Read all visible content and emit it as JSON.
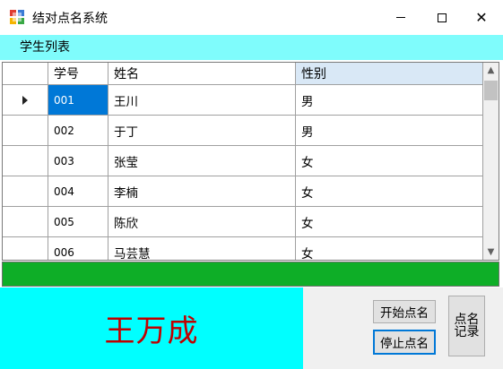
{
  "window": {
    "title": "结对点名系统",
    "minimize_icon": "minimize-icon",
    "maximize_icon": "maximize-icon",
    "close_glyph": "✕"
  },
  "menu": {
    "items": [
      {
        "label": "学生列表"
      }
    ]
  },
  "table": {
    "headers": {
      "id": "学号",
      "name": "姓名",
      "gender": "性别"
    },
    "selected_row": 0,
    "rows": [
      {
        "id": "001",
        "name": "王川",
        "gender": "男"
      },
      {
        "id": "002",
        "name": "于丁",
        "gender": "男"
      },
      {
        "id": "003",
        "name": "张莹",
        "gender": "女"
      },
      {
        "id": "004",
        "name": "李楠",
        "gender": "女"
      },
      {
        "id": "005",
        "name": "陈欣",
        "gender": "女"
      },
      {
        "id": "006",
        "name": "马芸慧",
        "gender": "女"
      }
    ]
  },
  "scrollbar": {
    "up_glyph": "▲",
    "down_glyph": "▼"
  },
  "current_name": "王万成",
  "buttons": {
    "start": "开始点名",
    "stop": "停止点名",
    "record": "点名记录"
  },
  "colors": {
    "menu_bg": "#7ffcfc",
    "progress_bar": "#0eae27",
    "name_panel_bg": "#00ffff",
    "name_text": "#c00000",
    "selection": "#0078d7"
  }
}
